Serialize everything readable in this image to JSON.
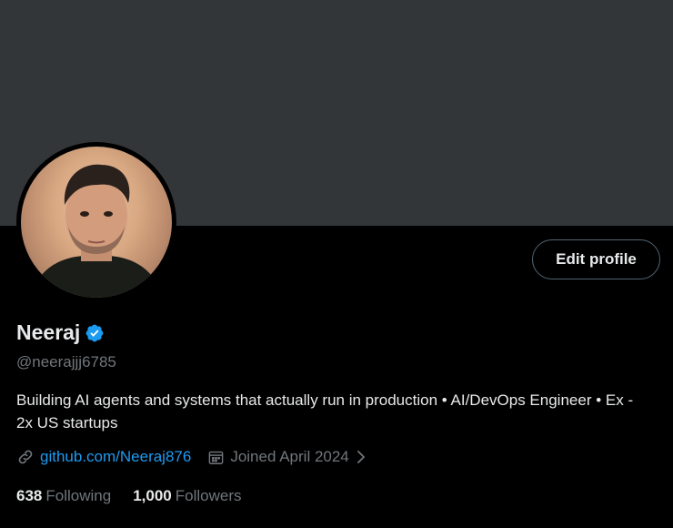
{
  "profile": {
    "display_name": "Neeraj",
    "handle": "@neerajjj6785",
    "bio": "Building AI agents and systems that actually run in production • AI/DevOps Engineer • Ex - 2x US startups",
    "link": "github.com/Neeraj876",
    "joined": "Joined April 2024",
    "verified": true
  },
  "actions": {
    "edit_profile_label": "Edit profile"
  },
  "stats": {
    "following_count": "638",
    "following_label": "Following",
    "followers_count": "1,000",
    "followers_label": "Followers"
  },
  "icons": {
    "verified": "verified-badge-icon",
    "link": "link-icon",
    "calendar": "calendar-icon",
    "chevron": "chevron-right-icon"
  },
  "colors": {
    "background": "#000000",
    "banner": "#333639",
    "text_primary": "#e7e9ea",
    "text_secondary": "#71767b",
    "accent": "#1d9bf0",
    "border": "#536471"
  }
}
